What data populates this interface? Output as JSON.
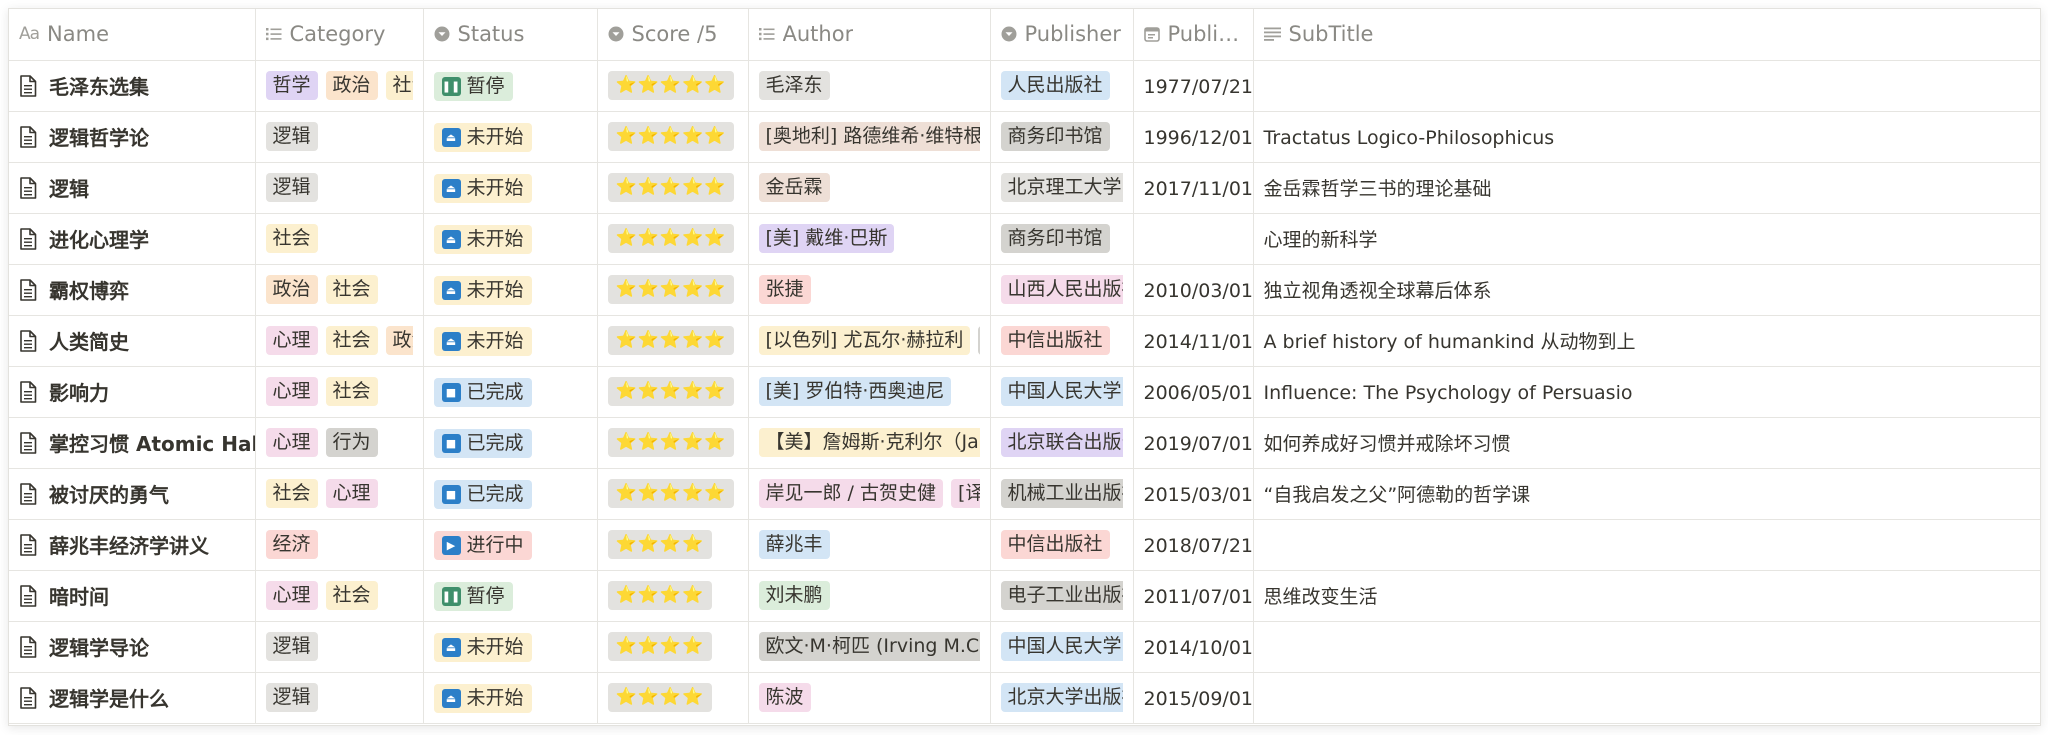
{
  "colors": {
    "header_text": "#8a8984",
    "border": "#e6e5e1",
    "star": "#f5b800",
    "status_pause_icon": "#3f8f6b",
    "status_notstarted_icon": "#2c7fc8",
    "status_done_icon": "#2c7fc8",
    "status_inprogress_icon": "#2c7fc8"
  },
  "columns": [
    {
      "key": "name",
      "label": "Name",
      "icon": "text-aa-icon",
      "width": 246
    },
    {
      "key": "category",
      "label": "Category",
      "icon": "list-icon",
      "width": 168
    },
    {
      "key": "status",
      "label": "Status",
      "icon": "select-icon",
      "width": 174
    },
    {
      "key": "score",
      "label": "Score /5",
      "icon": "select-icon",
      "width": 151
    },
    {
      "key": "author",
      "label": "Author",
      "icon": "list-icon",
      "width": 242
    },
    {
      "key": "publisher",
      "label": "Publisher",
      "icon": "select-icon",
      "width": 143
    },
    {
      "key": "published",
      "label": "Publishi...",
      "icon": "calendar-icon",
      "width": 120
    },
    {
      "key": "subtitle",
      "label": "SubTitle",
      "icon": "lines-icon",
      "width": 787
    }
  ],
  "rows": [
    {
      "name": "毛泽东选集",
      "category": [
        {
          "t": "哲学",
          "c": "lilac"
        },
        {
          "t": "政治",
          "c": "orange"
        },
        {
          "t": "社会",
          "c": "yellow"
        }
      ],
      "status": {
        "t": "暂停",
        "c": "green",
        "icon": "pause-icon",
        "glyph": "❚❚",
        "ic": "#3f8f6b"
      },
      "score": "⭐⭐⭐⭐⭐",
      "author": [
        {
          "t": "毛泽东",
          "c": "gray"
        }
      ],
      "publisher": {
        "t": "人民出版社",
        "c": "blue"
      },
      "published": "1977/07/21",
      "subtitle": ""
    },
    {
      "name": "逻辑哲学论",
      "category": [
        {
          "t": "逻辑",
          "c": "gray"
        }
      ],
      "status": {
        "t": "未开始",
        "c": "yellow",
        "icon": "eject-icon",
        "glyph": "⏏",
        "ic": "#2c7fc8"
      },
      "score": "⭐⭐⭐⭐⭐",
      "author": [
        {
          "t": "[奥地利] 路德维希·维特根斯坦",
          "c": "brown"
        }
      ],
      "publisher": {
        "t": "商务印书馆",
        "c": "graydk"
      },
      "published": "1996/12/01",
      "subtitle": "Tractatus Logico-Philosophicus"
    },
    {
      "name": "逻辑",
      "category": [
        {
          "t": "逻辑",
          "c": "gray"
        }
      ],
      "status": {
        "t": "未开始",
        "c": "yellow",
        "icon": "eject-icon",
        "glyph": "⏏",
        "ic": "#2c7fc8"
      },
      "score": "⭐⭐⭐⭐⭐",
      "author": [
        {
          "t": "金岳霖",
          "c": "brown"
        }
      ],
      "publisher": {
        "t": "北京理工大学出版",
        "c": "gray"
      },
      "published": "2017/11/01",
      "subtitle": "金岳霖哲学三书的理论基础"
    },
    {
      "name": "进化心理学",
      "category": [
        {
          "t": "社会",
          "c": "yellow"
        }
      ],
      "status": {
        "t": "未开始",
        "c": "yellow",
        "icon": "eject-icon",
        "glyph": "⏏",
        "ic": "#2c7fc8"
      },
      "score": "⭐⭐⭐⭐⭐",
      "author": [
        {
          "t": "[美] 戴维·巴斯",
          "c": "lilac"
        }
      ],
      "publisher": {
        "t": "商务印书馆",
        "c": "graydk"
      },
      "published": "",
      "subtitle": "心理的新科学"
    },
    {
      "name": "霸权博弈",
      "category": [
        {
          "t": "政治",
          "c": "orange"
        },
        {
          "t": "社会",
          "c": "yellow"
        }
      ],
      "status": {
        "t": "未开始",
        "c": "yellow",
        "icon": "eject-icon",
        "glyph": "⏏",
        "ic": "#2c7fc8"
      },
      "score": "⭐⭐⭐⭐⭐",
      "author": [
        {
          "t": "张捷",
          "c": "red"
        }
      ],
      "publisher": {
        "t": "山西人民出版社",
        "c": "pink"
      },
      "published": "2010/03/01",
      "subtitle": "独立视角透视全球幕后体系"
    },
    {
      "name": "人类简史",
      "category": [
        {
          "t": "心理",
          "c": "pink"
        },
        {
          "t": "社会",
          "c": "yellow"
        },
        {
          "t": "政治",
          "c": "orange"
        }
      ],
      "status": {
        "t": "未开始",
        "c": "yellow",
        "icon": "eject-icon",
        "glyph": "⏏",
        "ic": "#2c7fc8"
      },
      "score": "⭐⭐⭐⭐⭐",
      "author": [
        {
          "t": "[以色列] 尤瓦尔·赫拉利",
          "c": "yellow"
        },
        {
          "t": "[译]林",
          "c": "graydk"
        }
      ],
      "publisher": {
        "t": "中信出版社",
        "c": "red"
      },
      "published": "2014/11/01",
      "subtitle": "A brief history of humankind 从动物到上"
    },
    {
      "name": "影响力",
      "category": [
        {
          "t": "心理",
          "c": "pink"
        },
        {
          "t": "社会",
          "c": "yellow"
        }
      ],
      "status": {
        "t": "已完成",
        "c": "blue",
        "icon": "stop-icon",
        "glyph": "■",
        "ic": "#2c7fc8"
      },
      "score": "⭐⭐⭐⭐⭐",
      "author": [
        {
          "t": "[美] 罗伯特·西奥迪尼",
          "c": "blue"
        }
      ],
      "publisher": {
        "t": "中国人民大学出版",
        "c": "blue"
      },
      "published": "2006/05/01",
      "subtitle": "Influence: The Psychology of Persuasio"
    },
    {
      "name": "掌控习惯 Atomic Habits",
      "category": [
        {
          "t": "心理",
          "c": "pink"
        },
        {
          "t": "行为",
          "c": "graydk"
        }
      ],
      "status": {
        "t": "已完成",
        "c": "blue",
        "icon": "stop-icon",
        "glyph": "■",
        "ic": "#2c7fc8"
      },
      "score": "⭐⭐⭐⭐⭐",
      "author": [
        {
          "t": "【美】詹姆斯·克利尔（James",
          "c": "yellow"
        }
      ],
      "publisher": {
        "t": "北京联合出版公司",
        "c": "lilac"
      },
      "published": "2019/07/01",
      "subtitle": "如何养成好习惯并戒除坏习惯"
    },
    {
      "name": "被讨厌的勇气",
      "category": [
        {
          "t": "社会",
          "c": "yellow"
        },
        {
          "t": "心理",
          "c": "pink"
        }
      ],
      "status": {
        "t": "已完成",
        "c": "blue",
        "icon": "stop-icon",
        "glyph": "■",
        "ic": "#2c7fc8"
      },
      "score": "⭐⭐⭐⭐⭐",
      "author": [
        {
          "t": "岸见一郎 / 古贺史健",
          "c": "pink"
        },
        {
          "t": "[译]渠海",
          "c": "pink"
        }
      ],
      "publisher": {
        "t": "机械工业出版社",
        "c": "graydk"
      },
      "published": "2015/03/01",
      "subtitle": "“自我启发之父”阿德勒的哲学课"
    },
    {
      "name": "薛兆丰经济学讲义",
      "category": [
        {
          "t": "经济",
          "c": "red"
        }
      ],
      "status": {
        "t": "进行中",
        "c": "red",
        "icon": "play-icon",
        "glyph": "▶",
        "ic": "#2c7fc8"
      },
      "score": "⭐⭐⭐⭐",
      "author": [
        {
          "t": "薛兆丰",
          "c": "blue"
        }
      ],
      "publisher": {
        "t": "中信出版社",
        "c": "red"
      },
      "published": "2018/07/21",
      "subtitle": ""
    },
    {
      "name": "暗时间",
      "category": [
        {
          "t": "心理",
          "c": "pink"
        },
        {
          "t": "社会",
          "c": "yellow"
        }
      ],
      "status": {
        "t": "暂停",
        "c": "green",
        "icon": "pause-icon",
        "glyph": "❚❚",
        "ic": "#3f8f6b"
      },
      "score": "⭐⭐⭐⭐",
      "author": [
        {
          "t": "刘未鹏",
          "c": "green"
        }
      ],
      "publisher": {
        "t": "电子工业出版社",
        "c": "graydk"
      },
      "published": "2011/07/01",
      "subtitle": "思维改变生活"
    },
    {
      "name": "逻辑学导论",
      "category": [
        {
          "t": "逻辑",
          "c": "gray"
        }
      ],
      "status": {
        "t": "未开始",
        "c": "yellow",
        "icon": "eject-icon",
        "glyph": "⏏",
        "ic": "#2c7fc8"
      },
      "score": "⭐⭐⭐⭐",
      "author": [
        {
          "t": "欧文·M·柯匹 (Irving M.Copi)",
          "c": "graydk"
        },
        {
          "t": "",
          "c": "graydk"
        }
      ],
      "publisher": {
        "t": "中国人民大学出版",
        "c": "blue"
      },
      "published": "2014/10/01",
      "subtitle": ""
    },
    {
      "name": "逻辑学是什么",
      "category": [
        {
          "t": "逻辑",
          "c": "gray"
        }
      ],
      "status": {
        "t": "未开始",
        "c": "yellow",
        "icon": "eject-icon",
        "glyph": "⏏",
        "ic": "#2c7fc8"
      },
      "score": "⭐⭐⭐⭐",
      "author": [
        {
          "t": "陈波",
          "c": "pink"
        }
      ],
      "publisher": {
        "t": "北京大学出版社",
        "c": "blue"
      },
      "published": "2015/09/01",
      "subtitle": ""
    }
  ]
}
